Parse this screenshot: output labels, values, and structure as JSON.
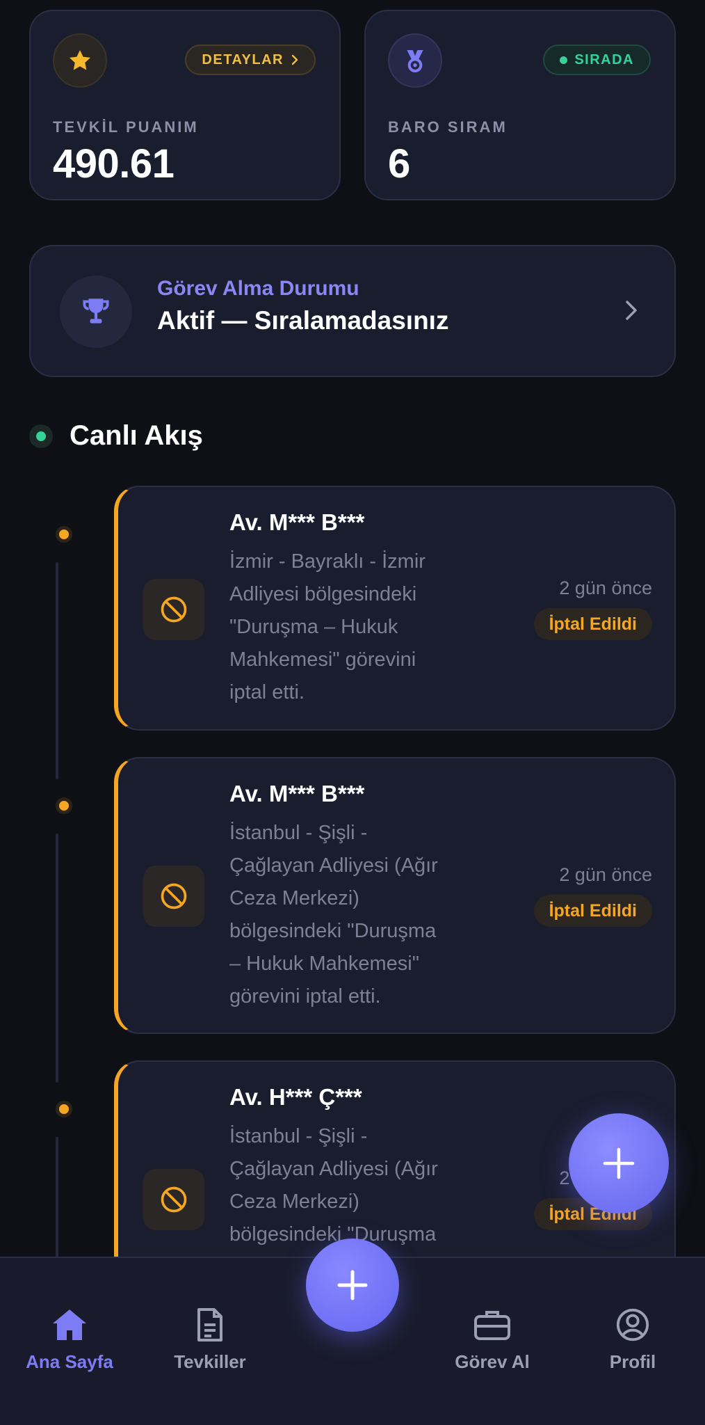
{
  "stats": {
    "score": {
      "label": "TEVKİL PUANIM",
      "value": "490.61",
      "pill": "DETAYLAR"
    },
    "rank": {
      "label": "BARO SIRAM",
      "value": "6",
      "pill": "SIRADA"
    }
  },
  "status_banner": {
    "label": "Görev Alma Durumu",
    "value": "Aktif — Sıralamadasınız"
  },
  "feed": {
    "title": "Canlı Akış",
    "items": [
      {
        "name": "Av. M*** B***",
        "lines": [
          "İzmir - Bayraklı - İzmir",
          "Adliyesi bölgesindeki",
          "\"Duruşma – Hukuk",
          "Mahkemesi\" görevini",
          "iptal etti."
        ],
        "time": "2 gün önce",
        "badge": "İptal Edildi"
      },
      {
        "name": "Av. M*** B***",
        "lines": [
          "İstanbul - Şişli -",
          "Çağlayan Adliyesi (Ağır",
          "Ceza Merkezi)",
          "bölgesindeki \"Duruşma",
          "– Hukuk Mahkemesi\"",
          "görevini iptal etti."
        ],
        "time": "2 gün önce",
        "badge": "İptal Edildi"
      },
      {
        "name": "Av. H*** Ç***",
        "lines": [
          "İstanbul - Şişli -",
          "Çağlayan Adliyesi (Ağır",
          "Ceza Merkezi)",
          "bölgesindeki \"Duruşma"
        ],
        "time": "2 gün önce",
        "badge": "İptal Edildi"
      }
    ]
  },
  "nav": {
    "home": "Ana Sayfa",
    "tevkiller": "Tevkiller",
    "gorev_al": "Görev Al",
    "profil": "Profil"
  },
  "colors": {
    "background": "#0f1016",
    "card": "#1a1d2e",
    "accent": "#6366f1",
    "warning": "#f5a623",
    "success": "#35d39a"
  },
  "icons": {
    "score": "star-icon",
    "rank": "medal-icon",
    "banner": "trophy-icon",
    "feed_item": "ban-icon",
    "fab": "plus-icon"
  }
}
